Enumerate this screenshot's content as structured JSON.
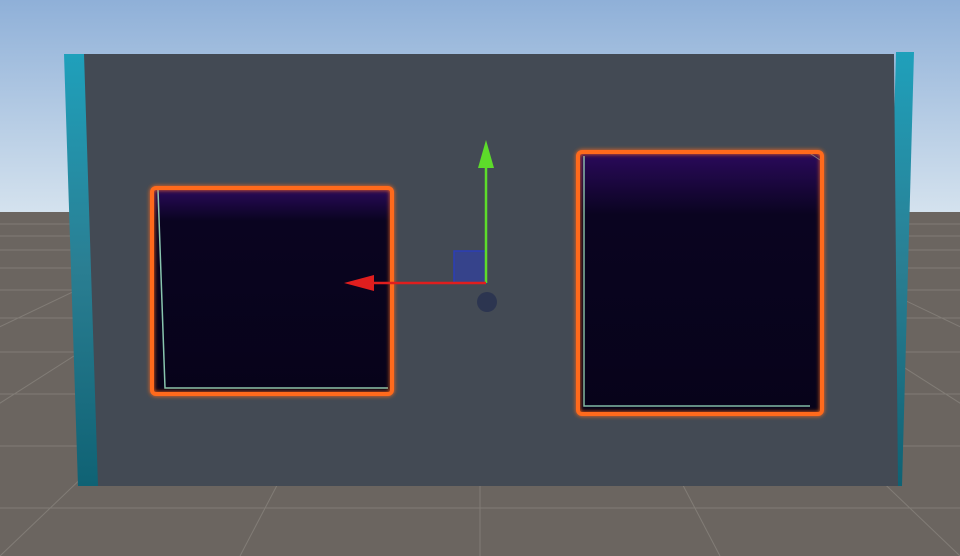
{
  "scene": {
    "colors": {
      "sky_top": "#8fb0d8",
      "sky_horizon": "#d4e2ee",
      "ground": "#6b6560",
      "grid_line": "#8a8580",
      "wall_face": "#434a54",
      "wall_edge": "#1f8fa6",
      "portal_fill": "#07031a",
      "portal_glow": "#2b0a5c",
      "selection_outline": "#ff6a1a",
      "inner_edge": "#9fe8c8",
      "gizmo_x_axis": "#e01e1e",
      "gizmo_y_axis": "#5ddc2a",
      "gizmo_plane_handle": "#2b3eb8",
      "gizmo_pivot": "#2a3350"
    },
    "objects": [
      {
        "name": "wall",
        "selected": false
      },
      {
        "name": "portal-left",
        "selected": true
      },
      {
        "name": "portal-right",
        "selected": true
      }
    ],
    "gizmo": {
      "tool": "move",
      "axes": [
        "x-axis-handle",
        "y-axis-handle",
        "xy-plane-handle"
      ]
    }
  }
}
